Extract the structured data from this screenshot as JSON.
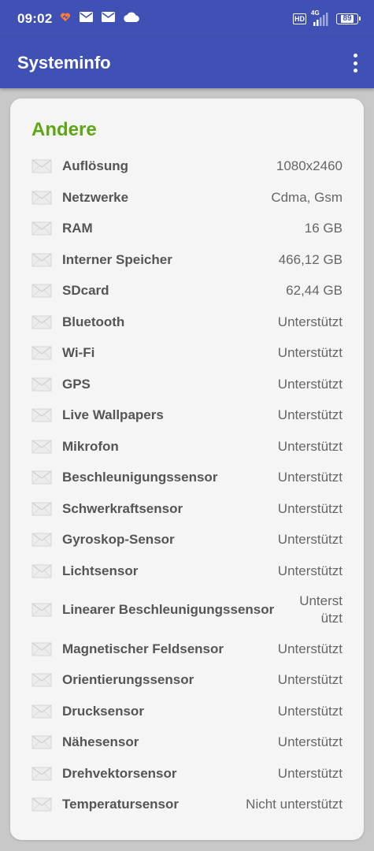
{
  "status_bar": {
    "time": "09:02",
    "left_icons": [
      "heart-app-icon",
      "mail-icon",
      "mail-icon",
      "cloud-icon"
    ],
    "hd_label": "HD",
    "network_label": "4G",
    "battery_level": "89"
  },
  "app_bar": {
    "title": "Systeminfo",
    "menu_icon": "more-vert-icon"
  },
  "section": {
    "title": "Andere",
    "title_color": "#5ea614"
  },
  "rows": [
    {
      "label": "Auflösung",
      "value": "1080x2460"
    },
    {
      "label": "Netzwerke",
      "value": "Cdma, Gsm"
    },
    {
      "label": "RAM",
      "value": "16 GB"
    },
    {
      "label": "Interner Speicher",
      "value": "466,12 GB"
    },
    {
      "label": "SDcard",
      "value": "62,44 GB"
    },
    {
      "label": "Bluetooth",
      "value": "Unterstützt"
    },
    {
      "label": "Wi-Fi",
      "value": "Unterstützt"
    },
    {
      "label": "GPS",
      "value": "Unterstützt"
    },
    {
      "label": "Live Wallpapers",
      "value": "Unterstützt"
    },
    {
      "label": "Mikrofon",
      "value": "Unterstützt"
    },
    {
      "label": "Beschleunigungssensor",
      "value": "Unterstützt"
    },
    {
      "label": "Schwerkraftsensor",
      "value": "Unterstützt"
    },
    {
      "label": "Gyroskop-Sensor",
      "value": "Unterstützt"
    },
    {
      "label": "Lichtsensor",
      "value": "Unterstützt"
    },
    {
      "label": "Linearer Beschleunigungssensor",
      "value": "Unterstützt"
    },
    {
      "label": "Magnetischer Feldsensor",
      "value": "Unterstützt"
    },
    {
      "label": "Orientierungssensor",
      "value": "Unterstützt"
    },
    {
      "label": "Drucksensor",
      "value": "Unterstützt"
    },
    {
      "label": "Nähesensor",
      "value": "Unterstützt"
    },
    {
      "label": "Drehvektorsensor",
      "value": "Unterstützt"
    },
    {
      "label": "Temperatursensor",
      "value": "Nicht unterstützt"
    }
  ],
  "colors": {
    "primary": "#3f51b5",
    "accent": "#5ea614",
    "background": "#c8c8c8",
    "card": "#f5f5f5"
  }
}
